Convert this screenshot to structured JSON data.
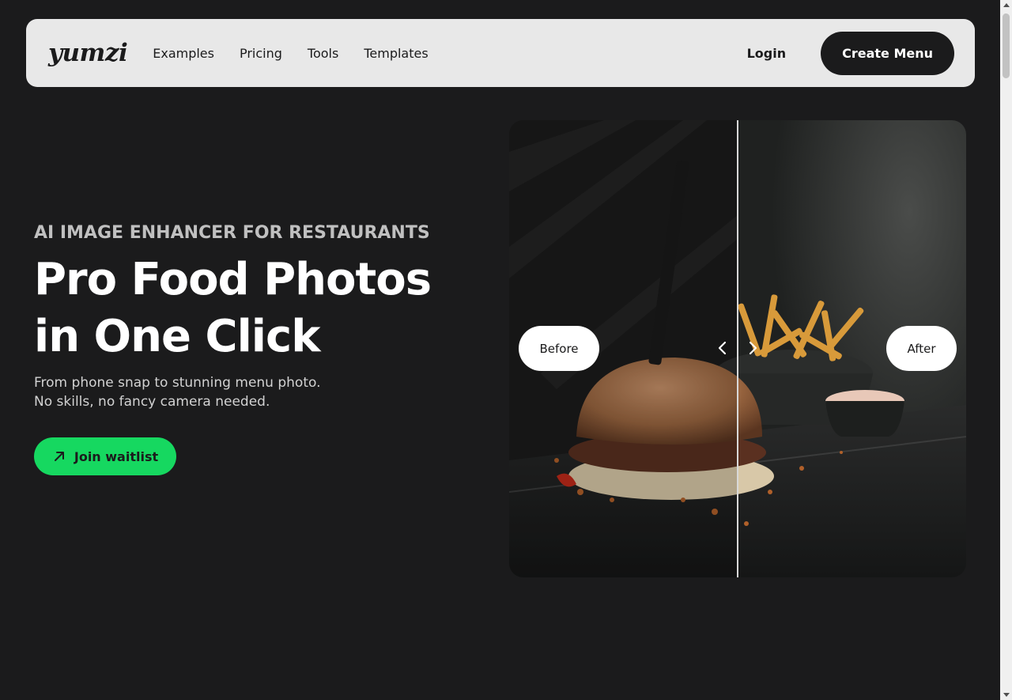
{
  "nav": {
    "logo": "yumzi",
    "links": [
      "Examples",
      "Pricing",
      "Tools",
      "Templates"
    ],
    "login": "Login",
    "cta": "Create Menu"
  },
  "hero": {
    "eyebrow": "AI IMAGE ENHANCER FOR RESTAURANTS",
    "headline_line1": "Pro Food Photos",
    "headline_line2": "in One Click",
    "sub_line1": "From phone snap to stunning menu photo.",
    "sub_line2": "No skills, no fancy camera needed.",
    "cta": "Join waitlist",
    "cta_icon": "arrow-up-right-icon"
  },
  "compare": {
    "before_label": "Before",
    "after_label": "After",
    "left_icon": "chevron-left-icon",
    "right_icon": "chevron-right-icon"
  },
  "colors": {
    "background": "#1b1b1c",
    "nav_background": "#e8e8e8",
    "accent_green": "#16d860"
  }
}
